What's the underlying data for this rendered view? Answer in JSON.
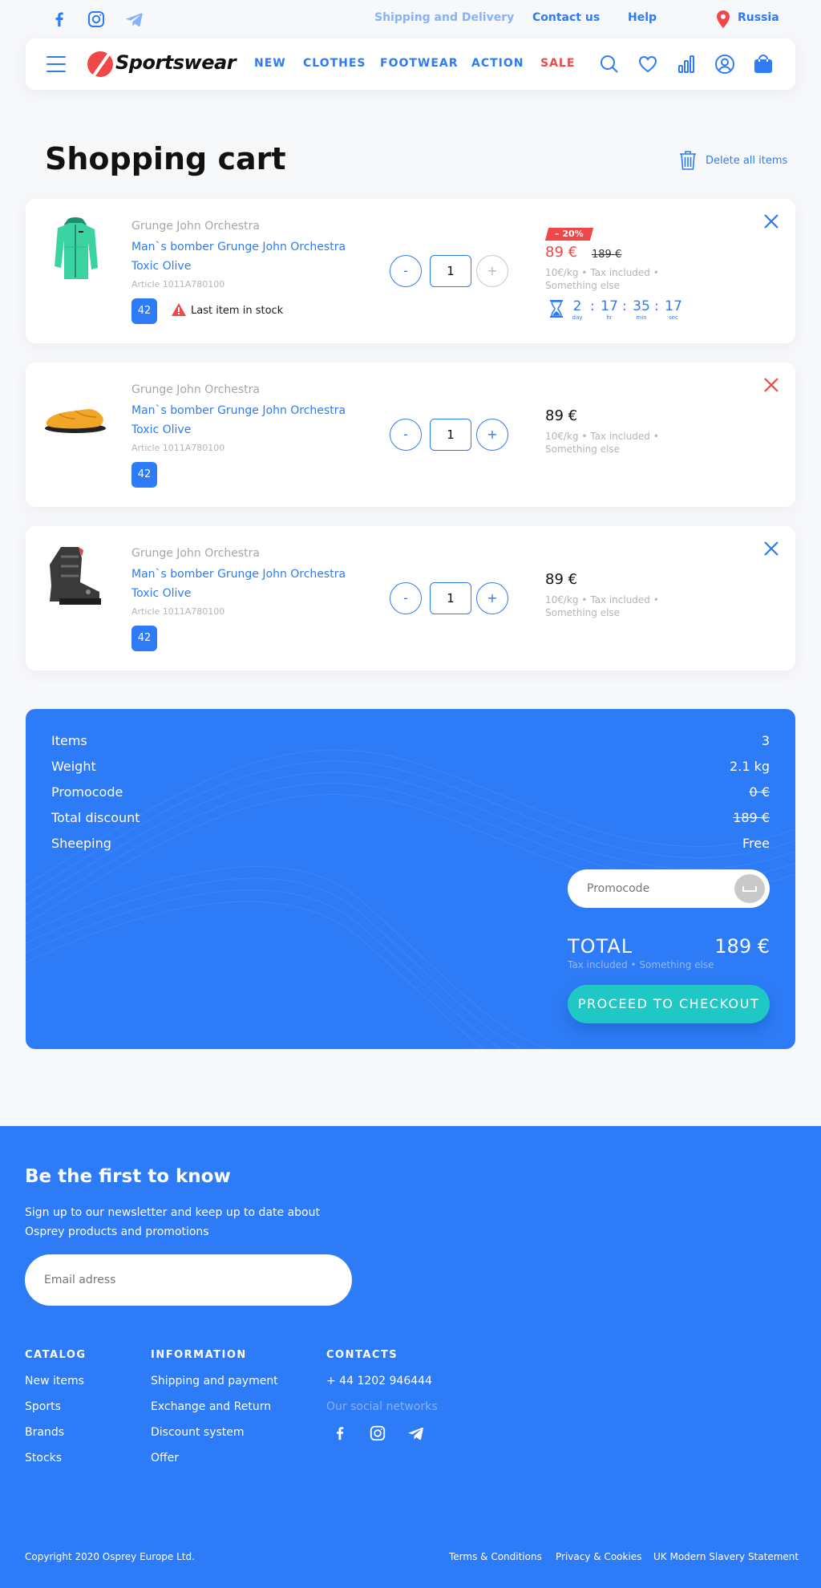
{
  "topbar": {
    "links": [
      "Shipping and Delivery",
      "Contact us",
      "Help"
    ],
    "region": "Russia"
  },
  "header": {
    "logo": "Sportswear",
    "nav": [
      "NEW",
      "CLOTHES",
      "FOOTWEAR",
      "ACTION",
      "SALE"
    ]
  },
  "page": {
    "title": "Shopping cart",
    "delete_all": "Delete all items"
  },
  "cart": {
    "items": [
      {
        "brand": "Grunge John Orchestra",
        "name": "Man`s bomber Grunge John Orchestra Toxic Olive",
        "article": "Article 1011A780100",
        "size": "42",
        "stock_warning": "Last item in stock",
        "quantity": "1",
        "minus": "-",
        "plus": "+",
        "discount": "– 20%",
        "price": "89 €",
        "old_price": "189 €",
        "price_note": "10€/kg • Tax included • Something else",
        "timer": {
          "day": "2",
          "hr": "17",
          "min": "35",
          "sec": "17",
          "labels": [
            "day",
            "hr",
            "min",
            "sec"
          ],
          "sep": ":"
        }
      },
      {
        "brand": "Grunge John Orchestra",
        "name": "Man`s bomber Grunge John Orchestra Toxic Olive",
        "article": "Article 1011A780100",
        "size": "42",
        "quantity": "1",
        "minus": "-",
        "plus": "+",
        "price": "89 €",
        "price_note": "10€/kg • Tax included • Something else"
      },
      {
        "brand": "Grunge John Orchestra",
        "name": "Man`s bomber Grunge John Orchestra Toxic Olive",
        "article": "Article 1011A780100",
        "size": "42",
        "quantity": "1",
        "minus": "-",
        "plus": "+",
        "price": "89 €",
        "price_note": "10€/kg • Tax included • Something else"
      }
    ]
  },
  "summary": {
    "rows": [
      {
        "label": "Items",
        "value": "3"
      },
      {
        "label": "Weight",
        "value": "2.1 kg"
      },
      {
        "label": "Promocode",
        "value": "0 €"
      },
      {
        "label": "Total discount",
        "value": "189 €"
      },
      {
        "label": "Sheeping",
        "value": "Free"
      }
    ],
    "promocode_placeholder": "Promocode",
    "total_label": "TOTAL",
    "total_value": "189 €",
    "total_note": "Tax included • Something else",
    "checkout": "PROCEED TO CHECKOUT"
  },
  "footer": {
    "title": "Be the first to know",
    "description": "Sign up to our newsletter and keep up to date about Osprey products and promotions",
    "email_placeholder": "Email adress",
    "catalog": {
      "heading": "CATALOG",
      "links": [
        "New items",
        "Sports",
        "Brands",
        "Stocks"
      ]
    },
    "information": {
      "heading": "INFORMATION",
      "links": [
        "Shipping and payment",
        "Exchange and Return",
        "Discount system",
        "Offer"
      ]
    },
    "contacts": {
      "heading": "CONTACTS",
      "phone": "+ 44 1202 946444",
      "social_label": "Our social networks"
    },
    "copyright": "Copyright 2020 Osprey Europe Ltd.",
    "legal": [
      "Terms & Conditions",
      "Privacy & Cookies",
      "UK Modern Slavery Statement"
    ]
  },
  "colors": {
    "accent": "#2d7bf6",
    "sale": "#f04848",
    "checkout": "#1fc8c4",
    "background": "#f7f8fa"
  },
  "icons": [
    "facebook-icon",
    "instagram-icon",
    "telegram-icon",
    "location-pin-icon",
    "menu-icon",
    "search-icon",
    "heart-icon",
    "compare-icon",
    "user-icon",
    "bag-icon",
    "trash-icon",
    "close-icon",
    "warning-icon",
    "hourglass-icon",
    "enter-icon"
  ]
}
